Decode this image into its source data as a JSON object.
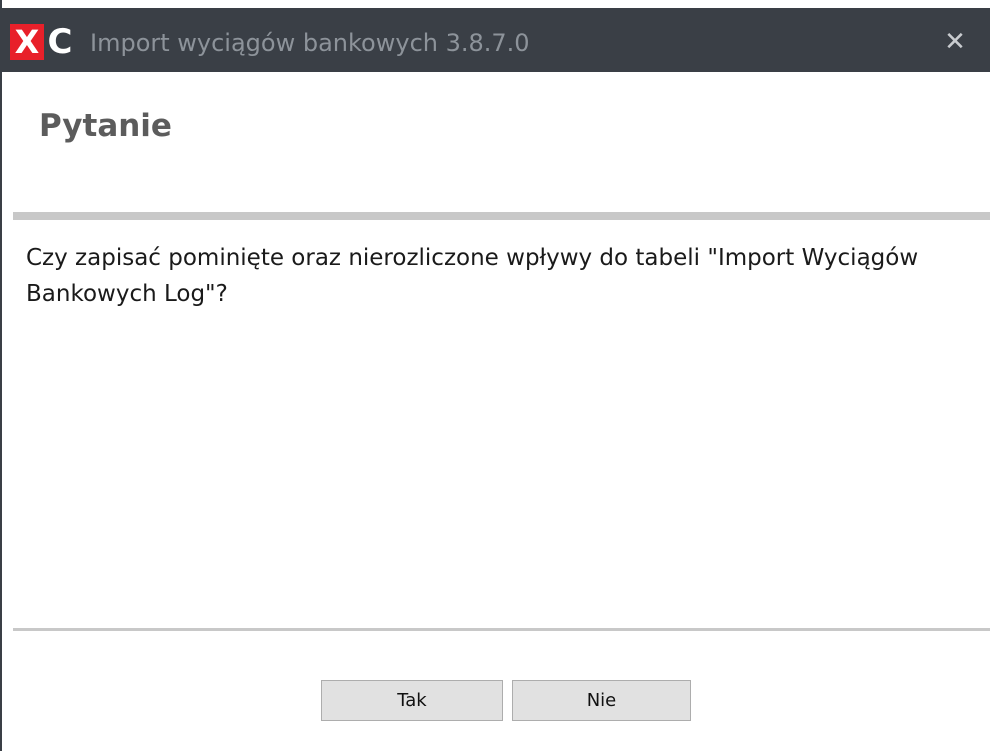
{
  "window": {
    "title": "Import wyciągów bankowych 3.8.7.0",
    "close_glyph": "✕",
    "logo": {
      "letter_x": "X",
      "letter_c": "C"
    },
    "colors": {
      "titlebar": "#3a3f46",
      "logo_red": "#e8202a"
    }
  },
  "dialog": {
    "heading": "Pytanie",
    "message": "Czy zapisać pominięte oraz nierozliczone wpływy do tabeli \"Import Wyciągów Bankowych Log\"?"
  },
  "buttons": {
    "yes_label": "Tak",
    "no_label": "Nie"
  }
}
